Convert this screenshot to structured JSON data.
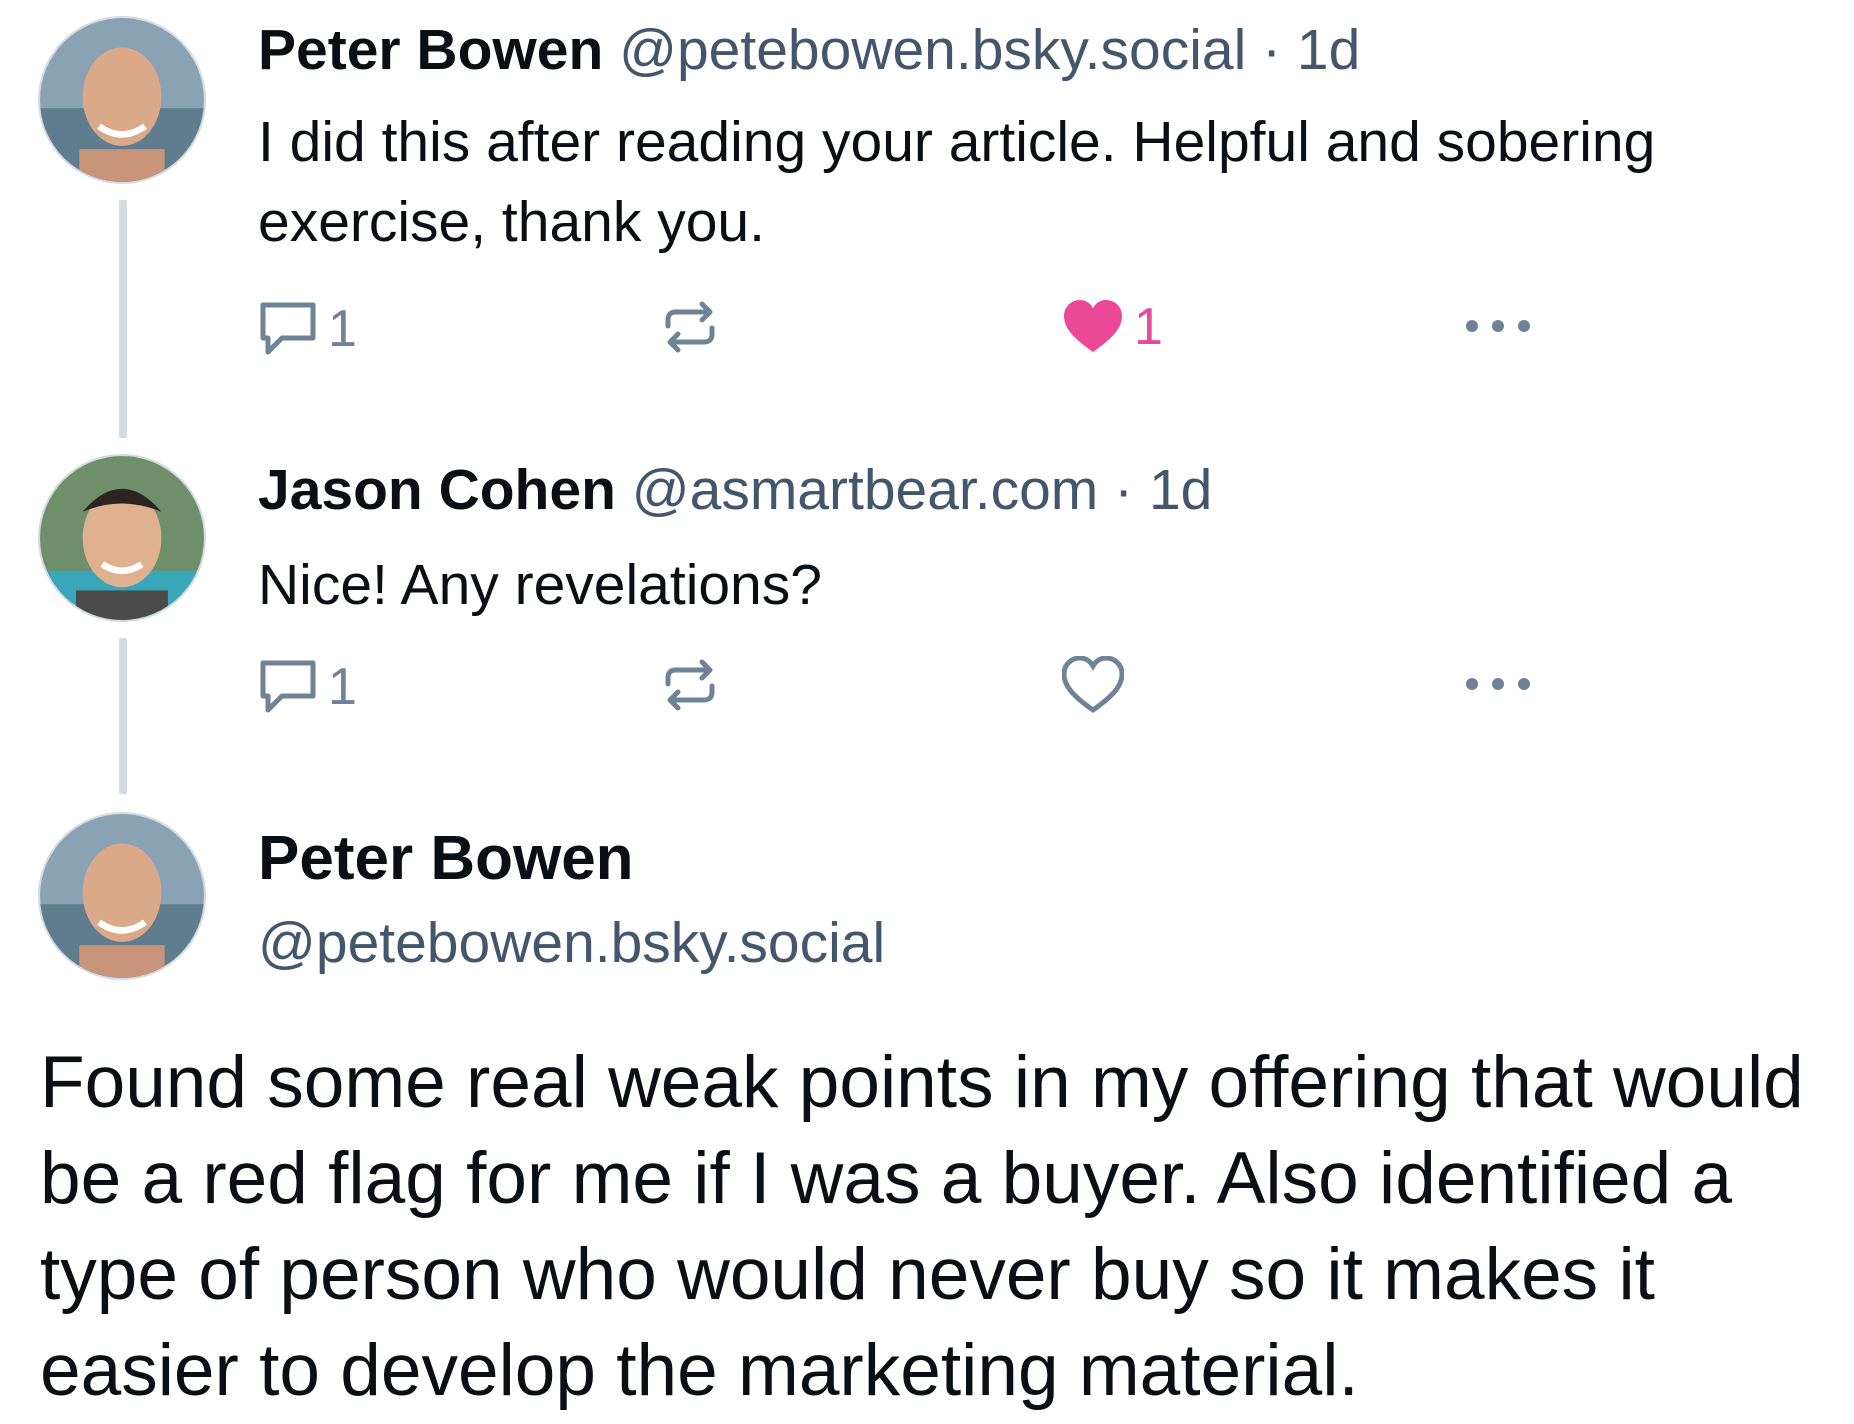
{
  "posts": [
    {
      "author_name": "Peter Bowen",
      "author_handle": "@petebowen.bsky.social",
      "separator": "·",
      "time": "1d",
      "text": "I did this after reading your article. Helpful and sobering exercise, thank you.",
      "reply_count": "1",
      "like_count": "1",
      "liked": true
    },
    {
      "author_name": "Jason Cohen",
      "author_handle": "@asmartbear.com",
      "separator": "·",
      "time": "1d",
      "text": "Nice!  Any revelations?",
      "reply_count": "1",
      "liked": false
    }
  ],
  "main_post": {
    "author_name": "Peter Bowen",
    "author_handle": "@petebowen.bsky.social",
    "text": "Found some real weak points in my offering that would be a red flag for me if I was a buyer. Also identified a type of person who would never buy so it makes it easier to develop the marketing material."
  },
  "icons": {
    "reply": "speech-bubble-icon",
    "repost": "repost-arrows-icon",
    "like": "heart-icon",
    "more": "ellipsis-icon"
  },
  "colors": {
    "icon": "#6f8396",
    "like_active": "#ec4899",
    "handle": "#42576c",
    "thread_line": "#d4dbe2"
  }
}
